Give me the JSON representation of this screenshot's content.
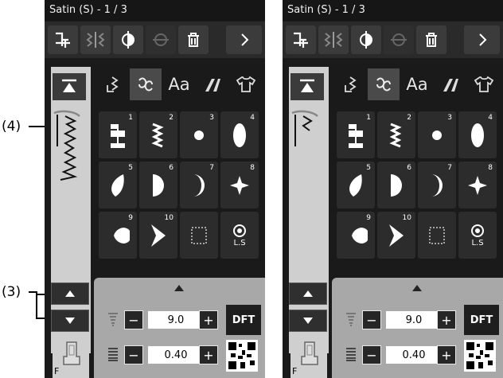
{
  "annotations": {
    "label4": "(4)",
    "label3": "(3)"
  },
  "panels": [
    {
      "title": "Satin (S) - 1 / 3",
      "width_value": "9.0",
      "length_value": "0.40",
      "dft_label": "DFT",
      "foot_label": "F"
    },
    {
      "title": "Satin (S) - 1 / 3",
      "width_value": "9.0",
      "length_value": "0.40",
      "dft_label": "DFT",
      "foot_label": "F"
    }
  ],
  "toolbar": [
    "needle-position-icon",
    "mirror-pattern-icon",
    "mirror-half-icon",
    "center-line-icon",
    "delete-icon",
    "next-arrow-icon"
  ],
  "categories": [
    {
      "label": "",
      "icon": "utility-stitch-icon"
    },
    {
      "label": "",
      "icon": "decorative-stitch-icon"
    },
    {
      "label": "Aa",
      "icon": "alphabet-icon"
    },
    {
      "label": "",
      "icon": "quilt-stitch-icon"
    },
    {
      "label": "",
      "icon": "garment-icon"
    }
  ],
  "stitch_numbers": [
    "1",
    "2",
    "3",
    "4",
    "5",
    "6",
    "7",
    "8",
    "9",
    "10"
  ],
  "special_cell": "L.S",
  "controls": {
    "minus": "−",
    "plus": "+"
  },
  "colors": {
    "screen_bg": "#1a1a1a",
    "toolbar": "#2a2a2a",
    "sidebar": "#cfcfcf",
    "lower_panel": "#a8a8a8"
  }
}
